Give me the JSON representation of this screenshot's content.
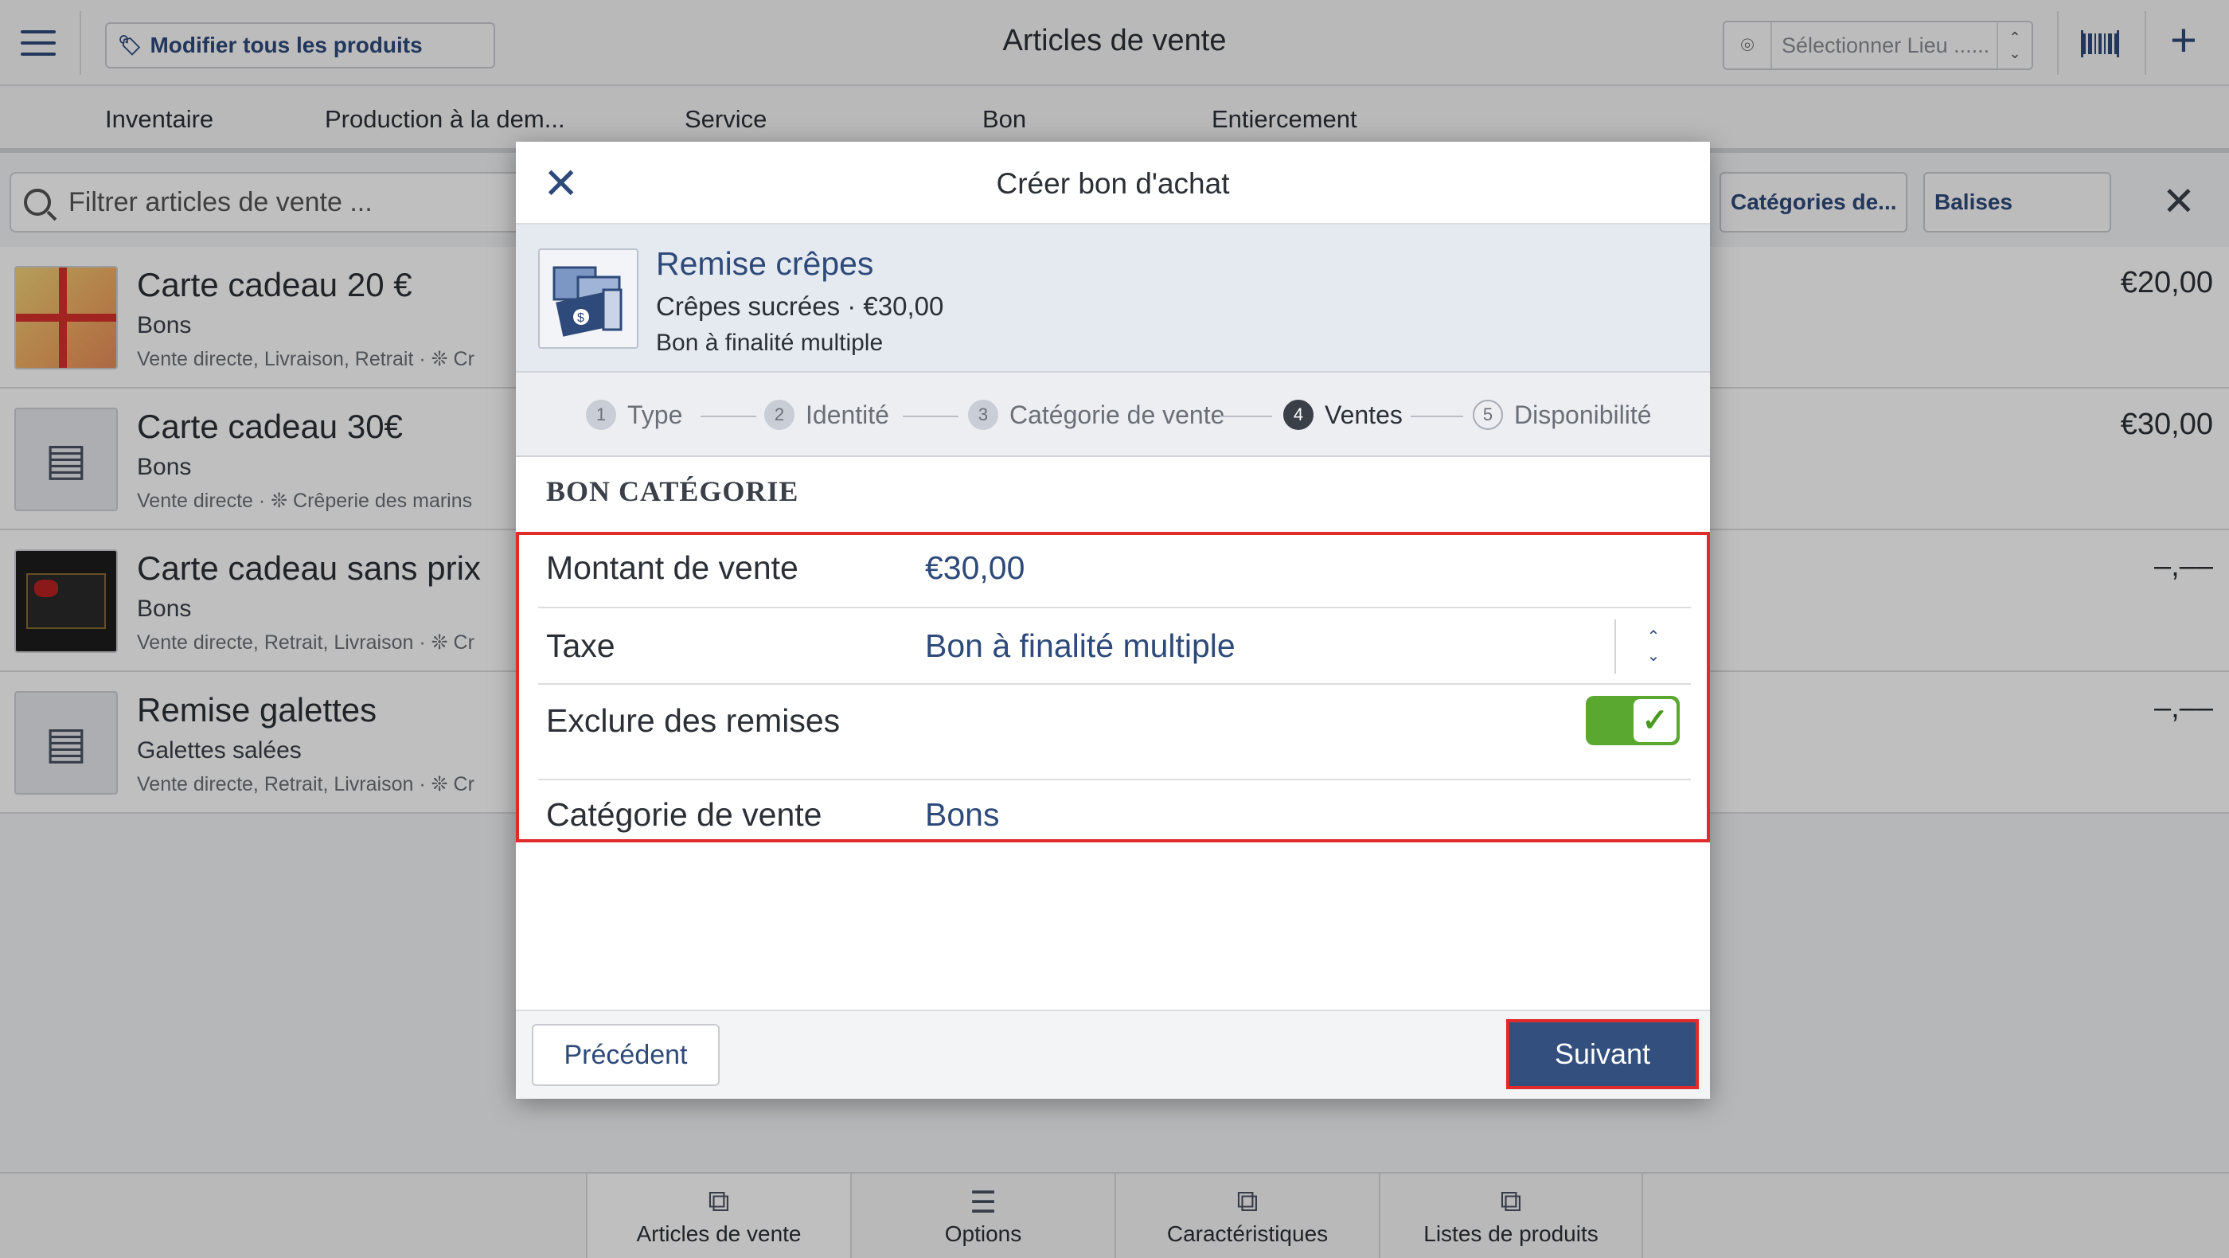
{
  "topbar": {
    "edit_all_label": "Modifier tous les produits",
    "page_title": "Articles de vente",
    "location_placeholder": "Sélectionner Lieu ......"
  },
  "tabs": [
    "Inventaire",
    "Production à la dem...",
    "Service",
    "Bon",
    "Entiercement"
  ],
  "filters": {
    "search_placeholder": "Filtrer articles de vente ...",
    "categories_chip": "Catégories de...",
    "tags_chip": "Balises"
  },
  "items": [
    {
      "title": "Carte cadeau 20 €",
      "subtitle": "Bons",
      "meta": "Vente directe, Livraison, Retrait · ❊ Cr",
      "price": "€20,00"
    },
    {
      "title": "Carte cadeau 30€",
      "subtitle": "Bons",
      "meta": "Vente directe · ❊ Crêperie des marins",
      "price": "€30,00"
    },
    {
      "title": "Carte cadeau sans prix",
      "subtitle": "Bons",
      "meta": "Vente directe, Retrait, Livraison · ❊ Cr",
      "price": "–,––"
    },
    {
      "title": "Remise galettes",
      "subtitle": "Galettes salées",
      "meta": "Vente directe, Retrait, Livraison · ❊ Cr",
      "price": "–,––"
    }
  ],
  "bottom_nav": [
    "Articles de vente",
    "Options",
    "Caractéristiques",
    "Listes de produits"
  ],
  "modal": {
    "title": "Créer bon d'achat",
    "summary": {
      "title": "Remise crêpes",
      "line1": "Crêpes sucrées · €30,00",
      "line2": "Bon à finalité multiple"
    },
    "steps": [
      {
        "num": "1",
        "label": "Type"
      },
      {
        "num": "2",
        "label": "Identité"
      },
      {
        "num": "3",
        "label": "Catégorie de vente"
      },
      {
        "num": "4",
        "label": "Ventes"
      },
      {
        "num": "5",
        "label": "Disponibilité"
      }
    ],
    "section_title": "BON CATÉGORIE",
    "form": {
      "amount_label": "Montant de vente",
      "amount_value": "€30,00",
      "tax_label": "Taxe",
      "tax_value": "Bon à finalité multiple",
      "exclude_label": "Exclure des remises",
      "exclude_on": true,
      "category_label": "Catégorie de vente",
      "category_value": "Bons"
    },
    "prev_label": "Précédent",
    "next_label": "Suivant"
  }
}
